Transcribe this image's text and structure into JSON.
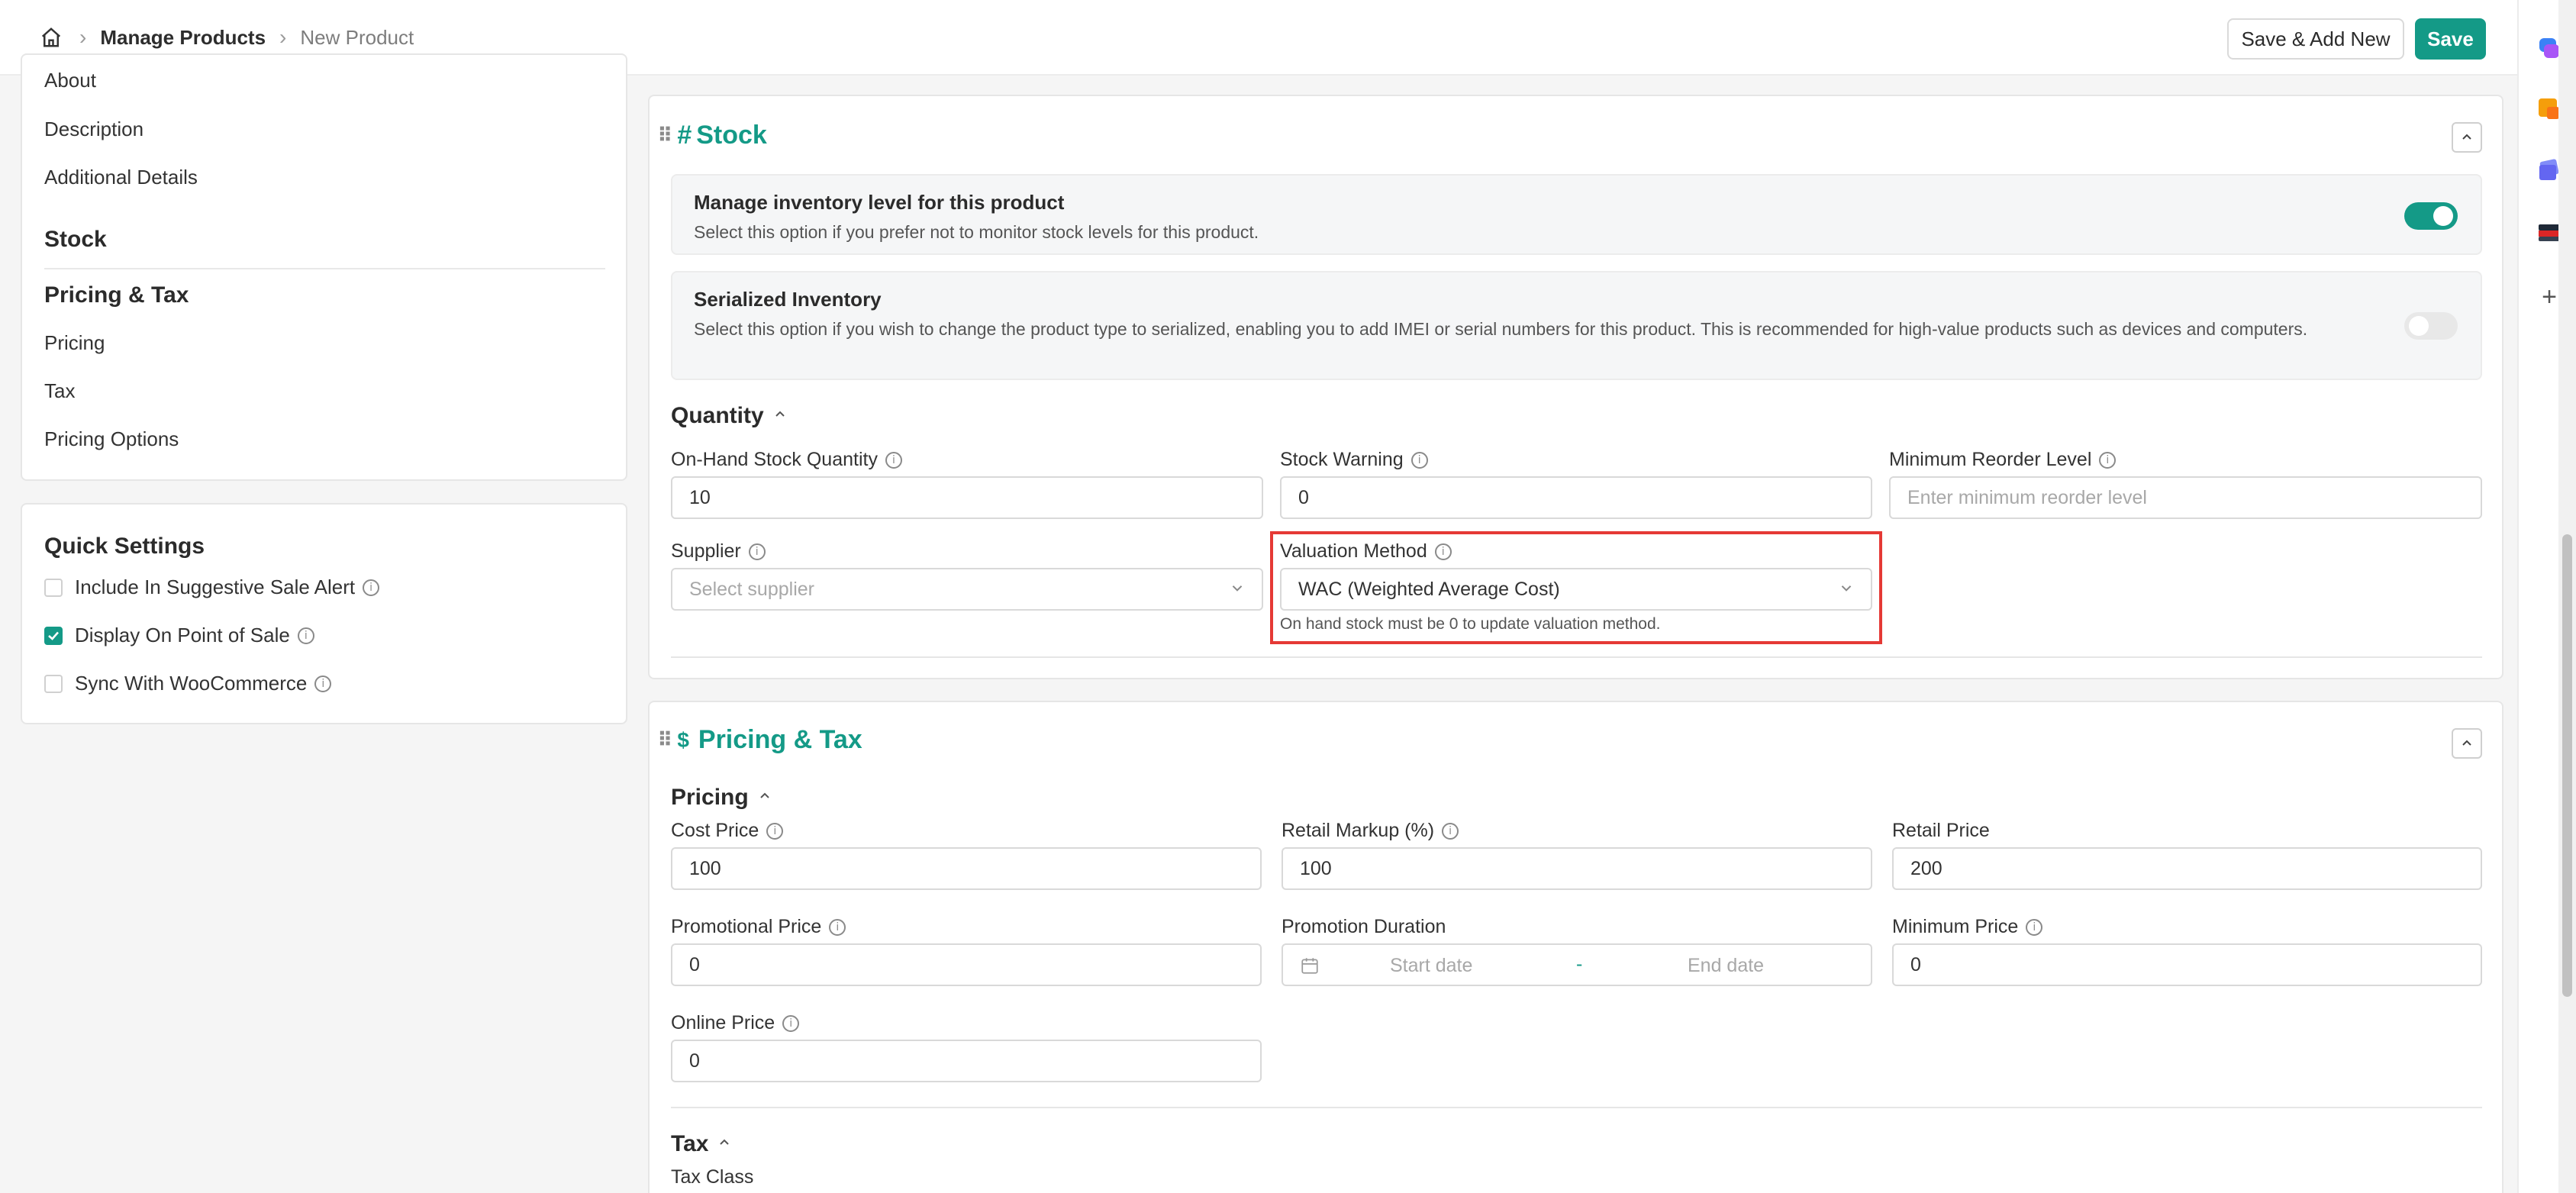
{
  "breadcrumb": {
    "root": "Manage Products",
    "current": "New Product"
  },
  "header": {
    "save_add_new_label": "Save & Add New",
    "save_label": "Save"
  },
  "sidebar": {
    "items_top": [
      "About",
      "Description",
      "Additional Details"
    ],
    "stock_heading": "Stock",
    "pricing_heading": "Pricing & Tax",
    "pricing_items": [
      "Pricing",
      "Tax",
      "Pricing Options"
    ]
  },
  "quick_settings": {
    "title": "Quick Settings",
    "options": [
      {
        "label": "Include In Suggestive Sale Alert",
        "checked": false
      },
      {
        "label": "Display On Point of Sale",
        "checked": true
      },
      {
        "label": "Sync With WooCommerce",
        "checked": false
      }
    ]
  },
  "stock": {
    "title": "Stock",
    "manage_inventory": {
      "title": "Manage inventory level for this product",
      "desc": "Select this option if you prefer not to monitor stock levels for this product.",
      "enabled": true
    },
    "serialized": {
      "title": "Serialized Inventory",
      "desc": "Select this option if you wish to change the product type to serialized, enabling you to add IMEI or serial numbers for this product. This is recommended for high-value products such as devices and computers.",
      "enabled": false
    },
    "quantity_heading": "Quantity",
    "on_hand_label": "On-Hand Stock Quantity",
    "on_hand_value": "10",
    "stock_warning_label": "Stock Warning",
    "stock_warning_value": "0",
    "min_reorder_label": "Minimum Reorder Level",
    "min_reorder_placeholder": "Enter minimum reorder level",
    "supplier_label": "Supplier",
    "supplier_placeholder": "Select supplier",
    "valuation_label": "Valuation Method",
    "valuation_value": "WAC (Weighted Average Cost)",
    "valuation_hint": "On hand stock must be 0 to update valuation method."
  },
  "pricing_tax": {
    "title": "Pricing & Tax",
    "pricing_heading": "Pricing",
    "cost_price_label": "Cost Price",
    "cost_price_value": "100",
    "retail_markup_label": "Retail Markup (%)",
    "retail_markup_value": "100",
    "retail_price_label": "Retail Price",
    "retail_price_value": "200",
    "promo_price_label": "Promotional Price",
    "promo_price_value": "0",
    "promo_duration_label": "Promotion Duration",
    "start_date_placeholder": "Start date",
    "date_separator": "-",
    "end_date_placeholder": "End date",
    "min_price_label": "Minimum Price",
    "min_price_value": "0",
    "online_price_label": "Online Price",
    "online_price_value": "0",
    "tax_heading": "Tax",
    "tax_class_label": "Tax Class"
  },
  "colors": {
    "accent": "#149a87",
    "highlight": "#e53935"
  },
  "icons": [
    "home-icon",
    "chevron-right-icon",
    "info-icon",
    "chevron-up-icon",
    "chevron-down-icon",
    "calendar-icon",
    "drag-handle-icon",
    "plus-icon"
  ]
}
